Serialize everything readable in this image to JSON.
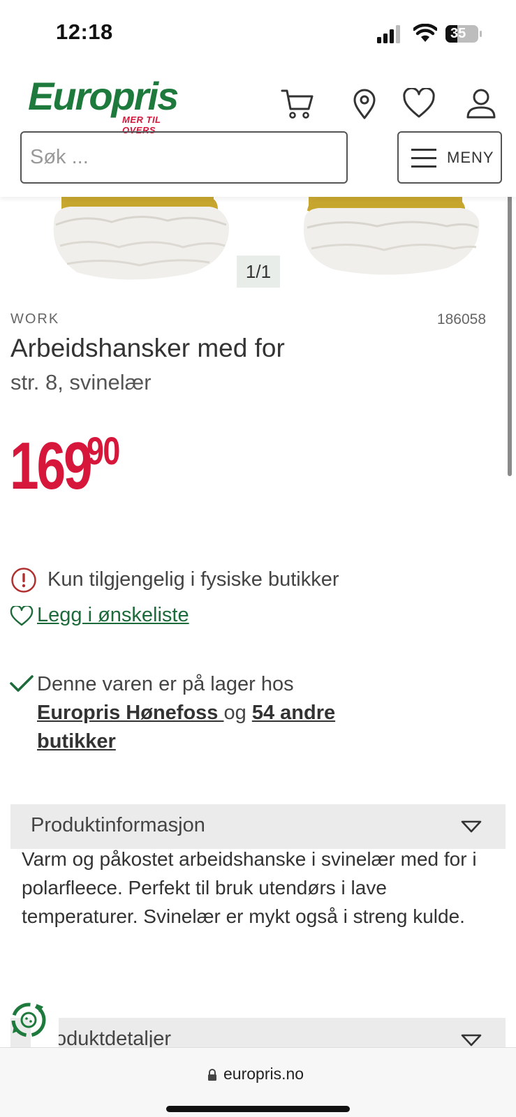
{
  "status_bar": {
    "time": "12:18",
    "battery": "35"
  },
  "header": {
    "logo_text": "Europris",
    "logo_tagline": "MER TIL OVERS",
    "search_placeholder": "Søk ...",
    "menu_label": "MENY",
    "icons": [
      "cart-icon",
      "location-pin-icon",
      "heart-icon",
      "user-icon"
    ]
  },
  "gallery": {
    "counter": "1/1"
  },
  "product": {
    "brand": "WORK",
    "sku": "186058",
    "title": "Arbeidshansker med for",
    "subtitle": "str. 8, svinelær",
    "price_main": "169",
    "price_cents": "90"
  },
  "availability": {
    "notice": "Kun tilgjengelig i fysiske butikker",
    "wishlist_link": "Legg i ønskeliste",
    "stock_text": "Denne varen er på lager hos",
    "store_name": "Europris Hønefoss ",
    "stock_and": "og",
    "other_stores": "54 andre",
    "other_stores_2": "butikker"
  },
  "accordions": {
    "info_title": "Produktinformasjon",
    "info_body": "Varm og påkostet arbeidshanske i svinelær med for i polarfleece. Perfekt til bruk utendørs i lave temperaturer. Svinelær er mykt også i streng kulde.",
    "details_title": "oduktdetaljer"
  },
  "browser": {
    "url": "europris.no"
  },
  "colors": {
    "brand_green": "#1e7a3c",
    "price_red": "#d6163a",
    "link_green": "#1d6b3a"
  }
}
